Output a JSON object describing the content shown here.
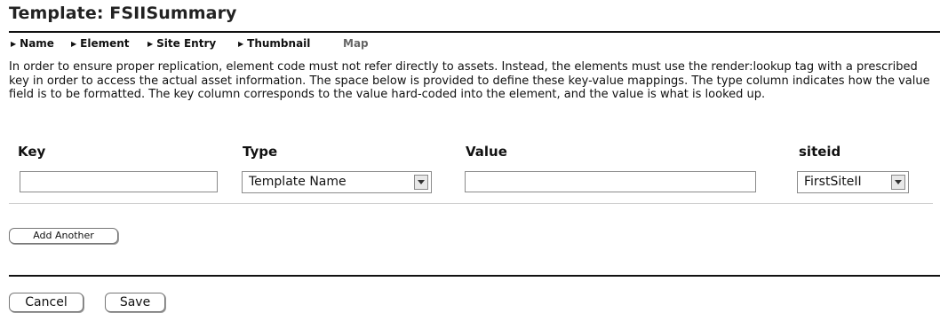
{
  "page_title": "Template: FSIISummary",
  "tabs": [
    {
      "label": "Name"
    },
    {
      "label": "Element"
    },
    {
      "label": "Site Entry"
    },
    {
      "label": "Thumbnail"
    },
    {
      "label": "Map"
    }
  ],
  "description": "In order to ensure proper replication, element code must not refer directly to assets. Instead, the elements must use the render:lookup tag with a prescribed key in order to access the actual asset information. The space below is provided to define these key-value mappings. The type column indicates how the value field is to be formatted. The key column corresponds to the value hard-coded into the element, and the value is what is looked up.",
  "columns": {
    "key": "Key",
    "type": "Type",
    "value": "Value",
    "siteid": "siteid"
  },
  "row": {
    "key_value": "",
    "type_selected": "Template Name",
    "value_value": "",
    "siteid_selected": "FirstSiteII"
  },
  "buttons": {
    "add_another": "Add Another",
    "cancel": "Cancel",
    "save": "Save"
  }
}
